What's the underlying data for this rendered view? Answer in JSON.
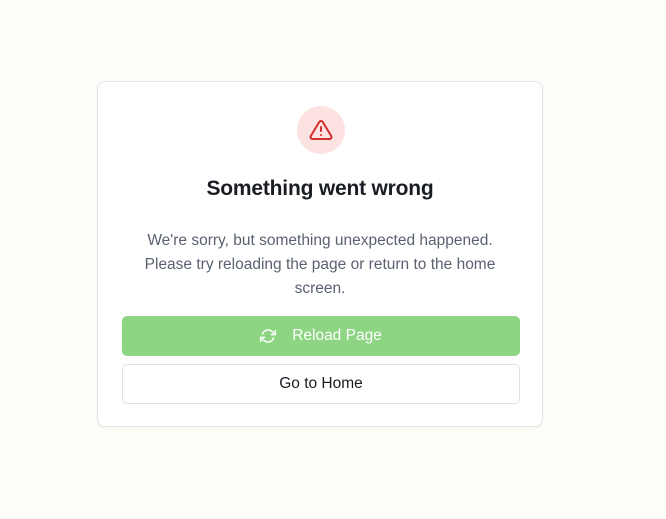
{
  "error": {
    "icon": "warning-triangle-icon",
    "title": "Something went wrong",
    "message": "We're sorry, but something unexpected happened. Please try reloading the page or return to the home screen."
  },
  "actions": {
    "reload_label": "Reload Page",
    "reload_icon": "refresh-icon",
    "home_label": "Go to Home"
  },
  "colors": {
    "background": "#fdfef9",
    "danger": "#d42f2f",
    "danger_bg": "#fde2e2",
    "primary": "#8dd483"
  }
}
